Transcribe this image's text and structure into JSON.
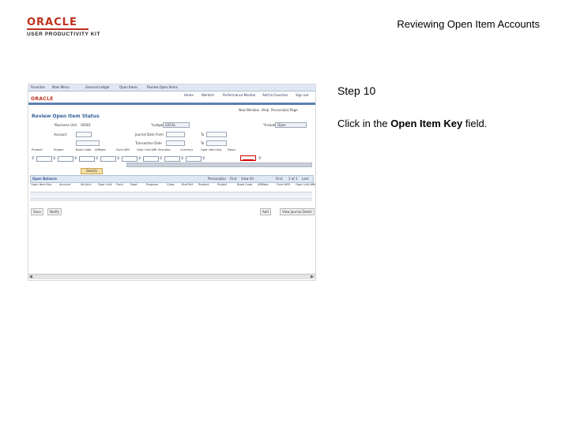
{
  "logo": {
    "brand": "ORACLE",
    "product": "USER PRODUCTIVITY KIT"
  },
  "document_title": "Reviewing Open Item Accounts",
  "step": {
    "label": "Step 10"
  },
  "instruction": {
    "prefix": "Click in the ",
    "emphasis": "Open Item Key",
    "suffix": " field."
  },
  "screenshot": {
    "top_nav": [
      "Favorites",
      "Main Menu",
      "General Ledger",
      "Open Items",
      "Review Open Items"
    ],
    "brand": "ORACLE",
    "header_links": [
      "Home",
      "Worklist",
      "Performance Monitor",
      "Add to Favorites",
      "Sign out"
    ],
    "view_links": [
      "New Window",
      "Help",
      "Personalize Page"
    ],
    "page_title": "Review Open Item Status",
    "business_unit_label": "*Business Unit",
    "business_unit_value": "US001",
    "ledger_label": "*Ledger",
    "ledger_value": "LOCAL",
    "include_label": "*Include",
    "include_value": "Open",
    "account_label": "Account",
    "journal_date_label": "Journal Date From",
    "to_label": "To",
    "accounting_date_label": "Transaction Date",
    "grid_headers": [
      "Product",
      "Project",
      "Book Code",
      "Affiliate",
      "Fund Affil",
      "Oper Unit Affil",
      "Scenario",
      "Currency",
      "Open Item Key",
      "Descr"
    ],
    "search_button": "Search",
    "open_balance": {
      "title": "Open Balance",
      "personalize": "Personalize",
      "find": "Find",
      "view_all": "View All",
      "pager": "First",
      "pager_range": "1 of 1",
      "last": "Last",
      "columns": [
        "Open Item Key",
        "Account",
        "Alt Acct",
        "Oper Unit",
        "Fund",
        "Dept",
        "Program",
        "Class",
        "Bud Ref",
        "Product",
        "Project",
        "Book Code",
        "Affiliate",
        "Fund Affil",
        "Oper Unit Affil"
      ]
    },
    "action_buttons": [
      "Save",
      "Notify",
      "Add",
      "View Journal Detail"
    ]
  }
}
